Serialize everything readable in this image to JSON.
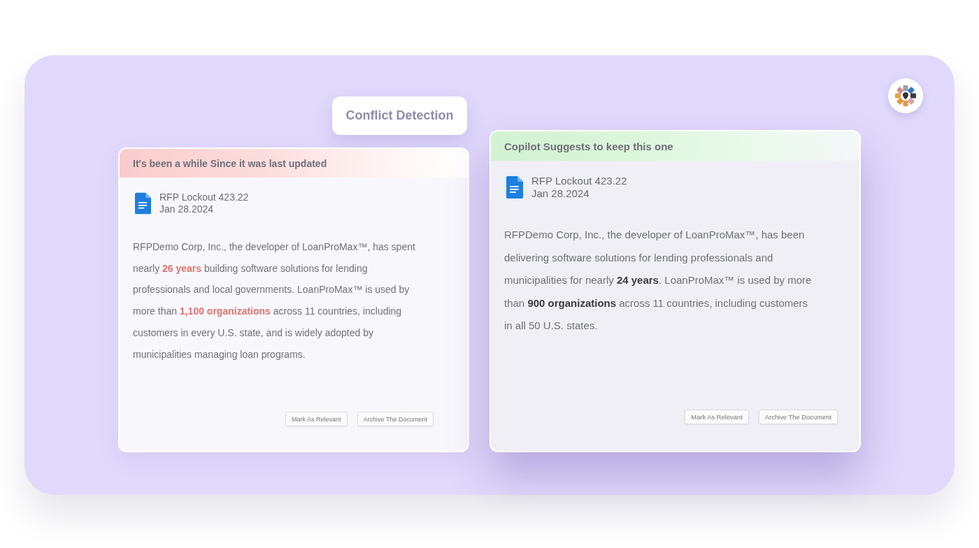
{
  "badge": {
    "label": "Conflict Detection"
  },
  "cards": [
    {
      "kind": "outdated",
      "banner": "It's been a while Since it was last updated",
      "document": {
        "title": "RFP Lockout 423.22",
        "date": "Jan 28.2024"
      },
      "description": "RFPDemo Corp, Inc., the developer of LoanProMax™, has spent nearly **26 years** building software solutions for lending professionals and local governments. LoanProMax™ is used by more than **1,100 organizations** across 11 countries, including customers in every U.S. state, and is widely adopted by municipalities managing loan programs.",
      "actions": [
        "Mark As Relevant",
        "Archive The Document"
      ]
    },
    {
      "kind": "suggested",
      "banner": "Copilot Suggests to keep this one",
      "document": {
        "title": "RFP Lockout 423.22",
        "date": "Jan 28.2024"
      },
      "description": "RFPDemo Corp, Inc., the developer of LoanProMax™, has been delivering software solutions for lending professionals and municipalities for nearly **24 years**. LoanProMax™ is used by more than **900 organizations** across 11 countries, including customers in all 50 U.S. states.",
      "actions": [
        "Mark As Relevant",
        "Archive The Document"
      ]
    }
  ]
}
